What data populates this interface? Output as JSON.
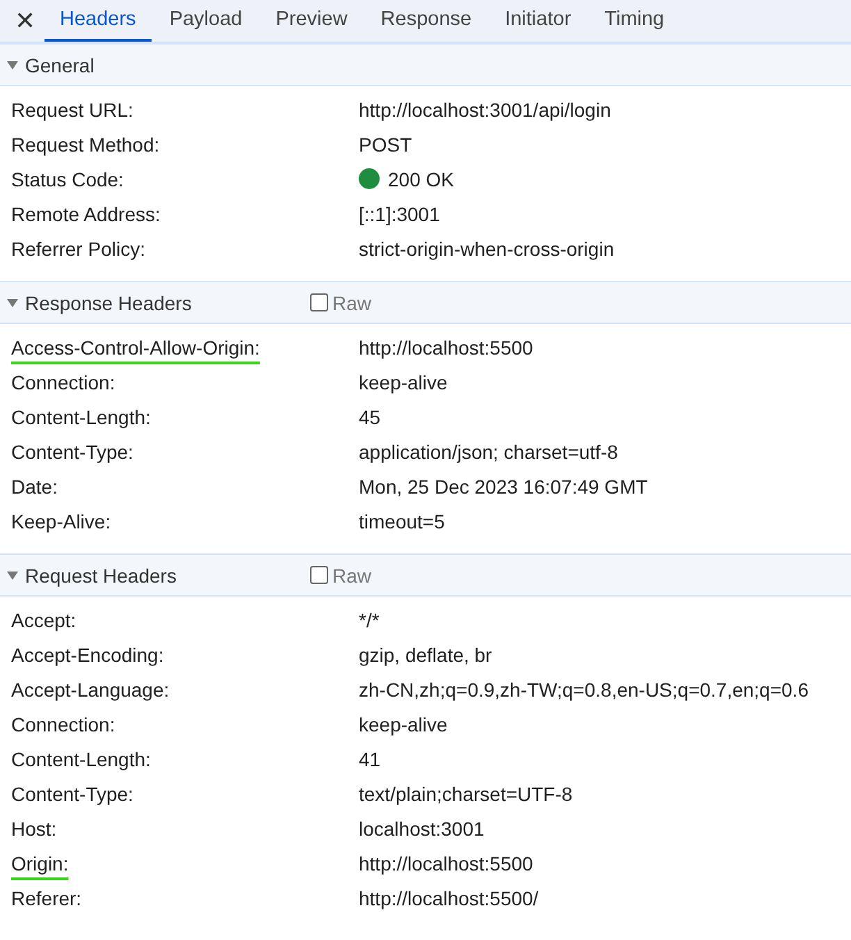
{
  "tabs": [
    {
      "label": "Headers",
      "selected": true
    },
    {
      "label": "Payload",
      "selected": false
    },
    {
      "label": "Preview",
      "selected": false
    },
    {
      "label": "Response",
      "selected": false
    },
    {
      "label": "Initiator",
      "selected": false
    },
    {
      "label": "Timing",
      "selected": false
    }
  ],
  "close_icon": "✕",
  "sections": [
    {
      "title": "General",
      "expanded": true,
      "rows": [
        {
          "name": "Request URL:",
          "value": "http://localhost:3001/api/login",
          "underlined": false
        },
        {
          "name": "Request Method:",
          "value": "POST",
          "underlined": false
        },
        {
          "name": "Status Code:",
          "value": "200 OK",
          "color": "#1e8e3e",
          "underlined": false
        },
        {
          "name": "Remote Address:",
          "value": "[::1]:3001",
          "underlined": false
        },
        {
          "name": "Referrer Policy:",
          "value": "strict-origin-when-cross-origin",
          "underlined": false
        }
      ]
    },
    {
      "title": "Response Headers",
      "expanded": true,
      "raw": {
        "label": "Raw",
        "checked": false
      },
      "rows": [
        {
          "name": "Access-Control-Allow-Origin:",
          "value": "http://localhost:5500",
          "underlined": true
        },
        {
          "name": "Connection:",
          "value": "keep-alive",
          "underlined": false
        },
        {
          "name": "Content-Length:",
          "value": "45",
          "underlined": false
        },
        {
          "name": "Content-Type:",
          "value": "application/json; charset=utf-8",
          "underlined": false
        },
        {
          "name": "Date:",
          "value": "Mon, 25 Dec 2023 16:07:49 GMT",
          "underlined": false
        },
        {
          "name": "Keep-Alive:",
          "value": "timeout=5",
          "underlined": false
        }
      ]
    },
    {
      "title": "Request Headers",
      "expanded": true,
      "raw": {
        "label": "Raw",
        "checked": false
      },
      "rows": [
        {
          "name": "Accept:",
          "value": "*/*",
          "underlined": false
        },
        {
          "name": "Accept-Encoding:",
          "value": "gzip, deflate, br",
          "underlined": false
        },
        {
          "name": "Accept-Language:",
          "value": "zh-CN,zh;q=0.9,zh-TW;q=0.8,en-US;q=0.7,en;q=0.6",
          "underlined": false
        },
        {
          "name": "Connection:",
          "value": "keep-alive",
          "underlined": false
        },
        {
          "name": "Content-Length:",
          "value": "41",
          "underlined": false
        },
        {
          "name": "Content-Type:",
          "value": "text/plain;charset=UTF-8",
          "underlined": false
        },
        {
          "name": "Host:",
          "value": "localhost:3001",
          "underlined": false
        },
        {
          "name": "Origin:",
          "value": "http://localhost:5500",
          "underlined": true
        },
        {
          "name": "Referer:",
          "value": "http://localhost:5500/",
          "underlined": false
        }
      ]
    }
  ]
}
